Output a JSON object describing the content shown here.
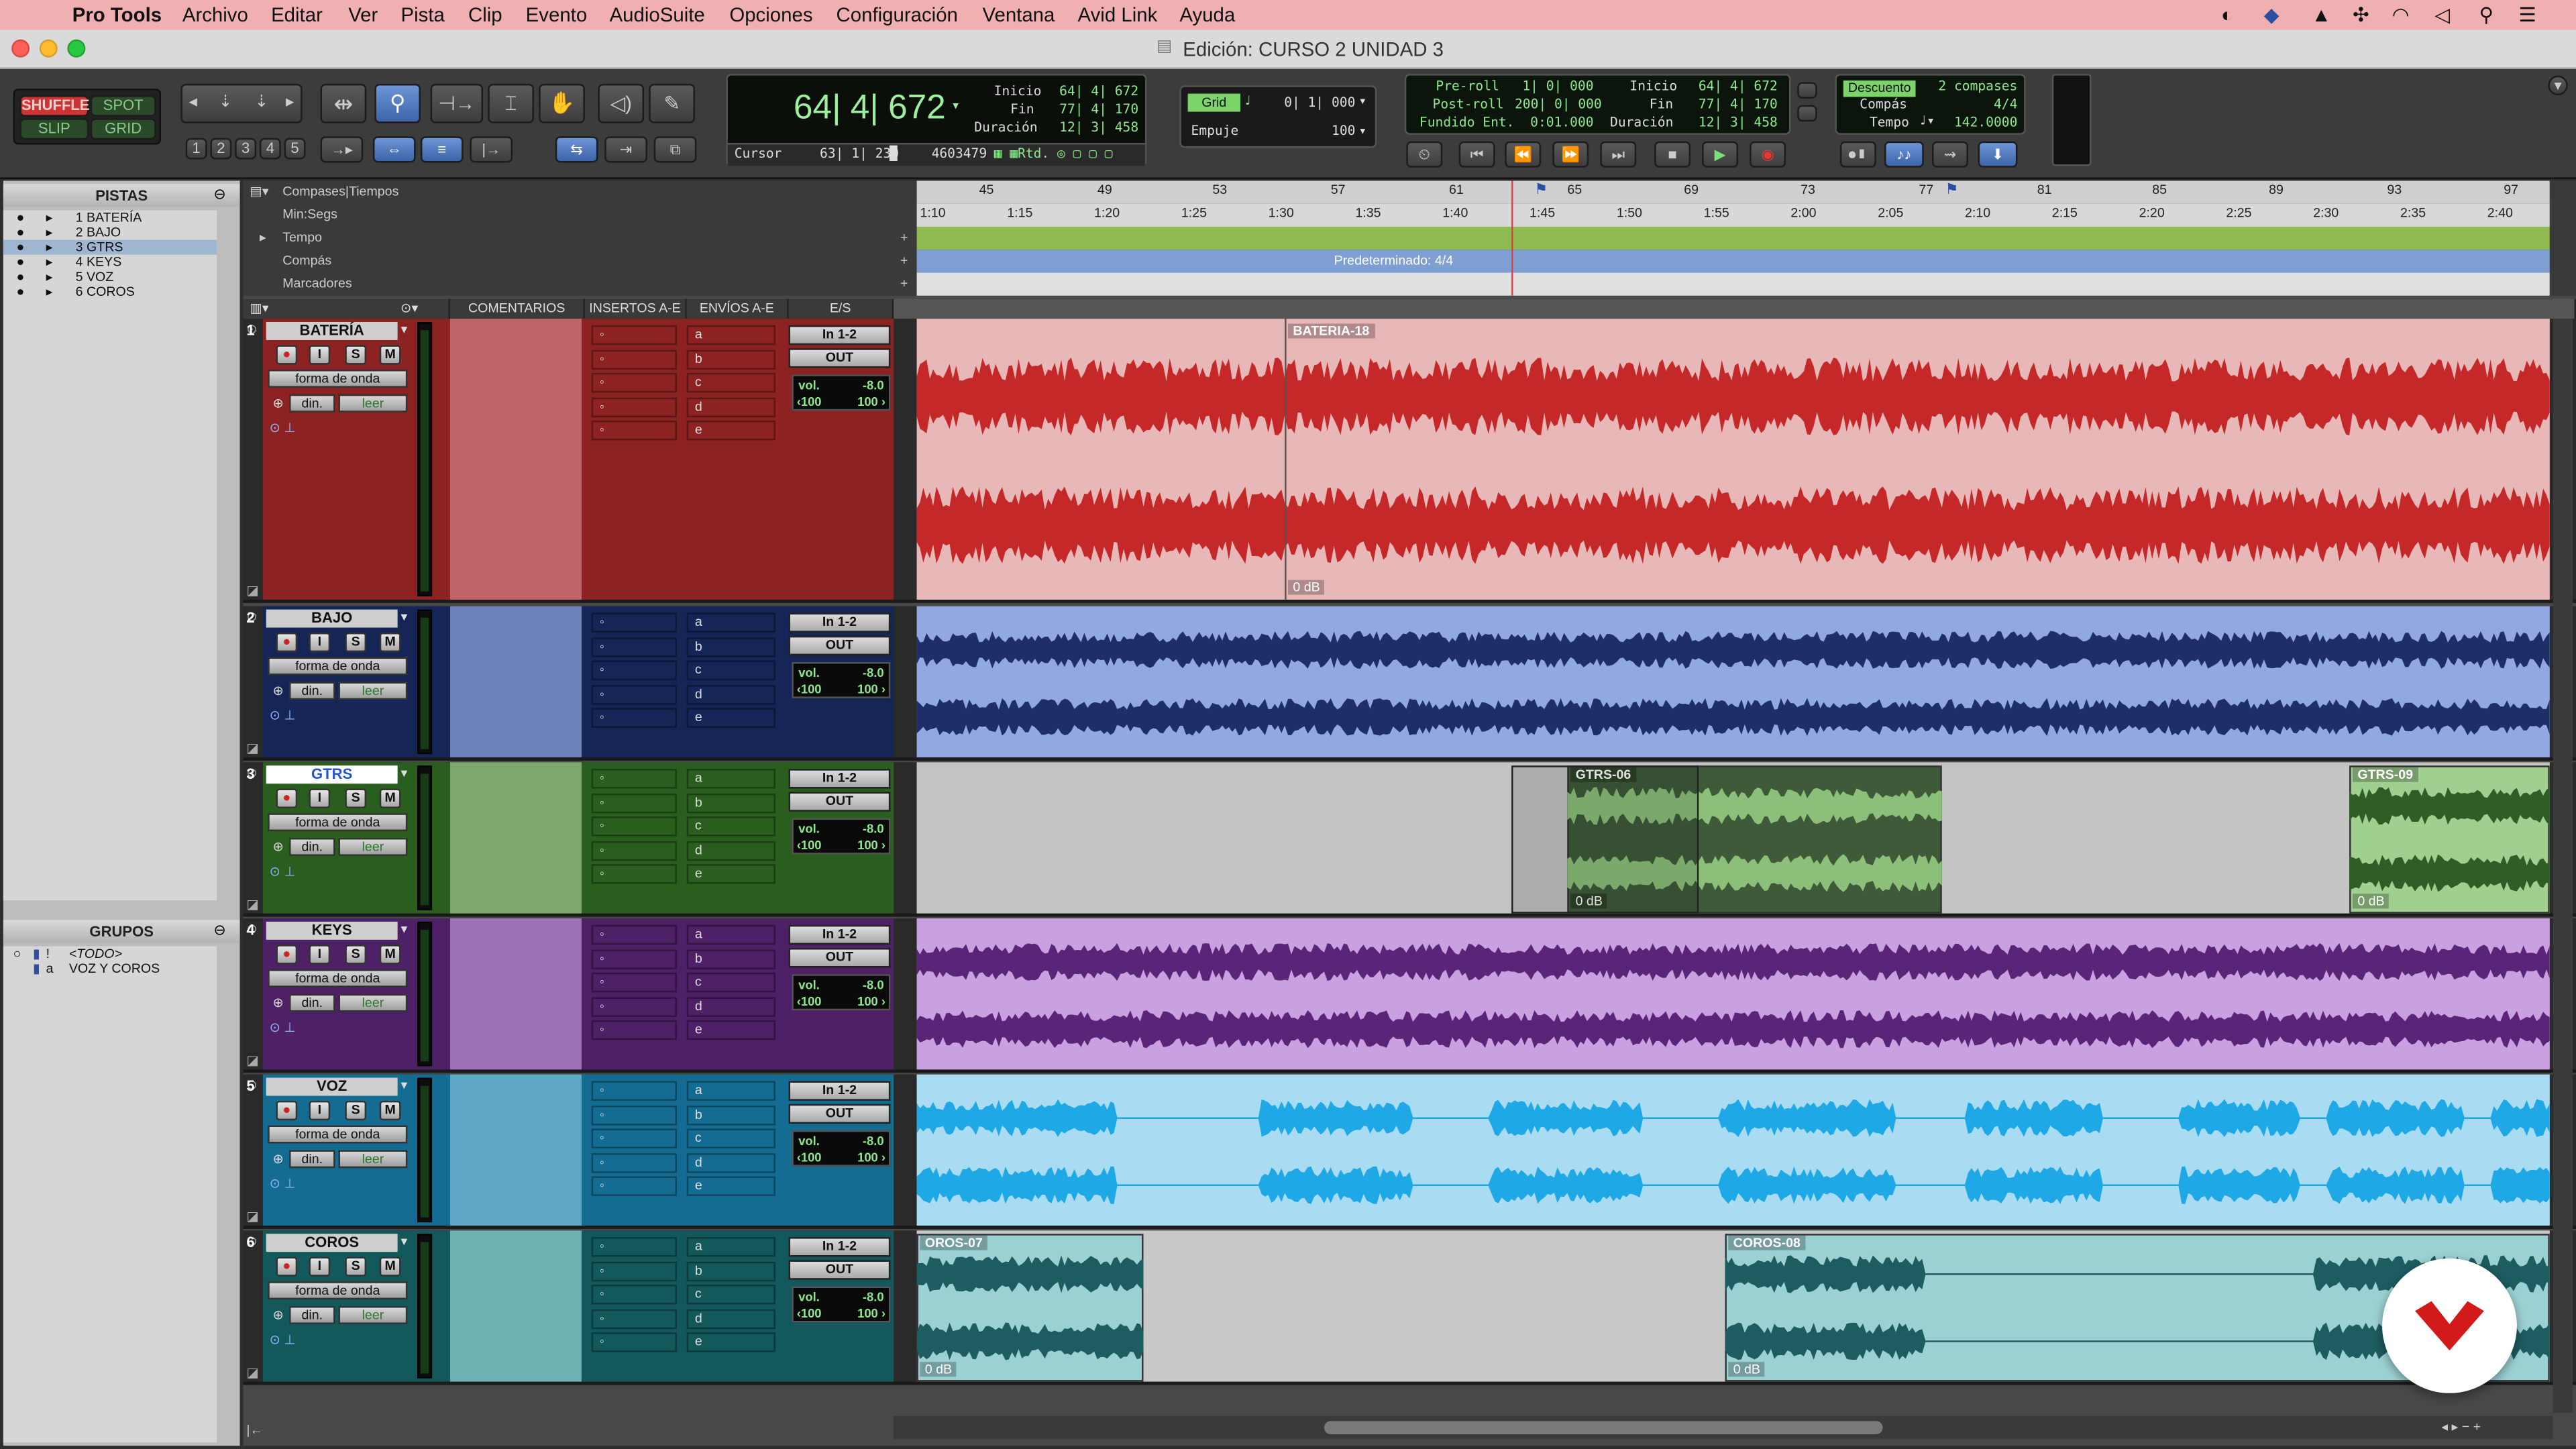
{
  "menubar": {
    "app": "Pro Tools",
    "items": [
      "Archivo",
      "Editar",
      "Ver",
      "Pista",
      "Clip",
      "Evento",
      "AudioSuite",
      "Opciones",
      "Configuración",
      "Ventana",
      "Avid Link",
      "Ayuda"
    ]
  },
  "window": {
    "title": "Edición: CURSO 2 UNIDAD 3"
  },
  "toolbar": {
    "modes": {
      "shuffle": "SHUFFLE",
      "spot": "SPOT",
      "slip": "SLIP",
      "grid": "GRID"
    },
    "zoom_presets": [
      "1",
      "2",
      "3",
      "4",
      "5"
    ],
    "main_counter": "64| 4| 672",
    "cursor_label": "Cursor",
    "cursor_value": "63| 1| 230",
    "cursor_samples": "4603479",
    "selection": {
      "inicio_label": "Inicio",
      "inicio": "64| 4| 672",
      "fin_label": "Fin",
      "fin": "77| 4| 170",
      "duracion_label": "Duración",
      "duracion": "12| 3| 458"
    },
    "grid": {
      "label": "Grid",
      "value": "0| 1| 000",
      "empuje_label": "Empuje",
      "empuje_value": "100"
    },
    "transport_counters": {
      "preroll_label": "Pre-roll",
      "preroll": "1| 0| 000",
      "postroll_label": "Post-roll",
      "postroll": "200| 0| 000",
      "fundido_label": "Fundido Ent.",
      "fundido": "0:01.000",
      "inicio_label": "Inicio",
      "inicio": "64| 4| 672",
      "fin_label": "Fin",
      "fin": "77| 4| 170",
      "duracion_label": "Duración",
      "duracion": "12| 3| 458"
    },
    "tempo_box": {
      "descuento_label": "Descuento",
      "descuento_value": "2 compases",
      "compas_label": "Compás",
      "compas_value": "4/4",
      "tempo_label": "Tempo",
      "tempo_value": "142.0000"
    }
  },
  "left_panel": {
    "tracks_title": "PISTAS",
    "tracks": [
      "1 BATERÍA",
      "2 BAJO",
      "3 GTRS",
      "4 KEYS",
      "5 VOZ",
      "6 COROS"
    ],
    "selected_track_index": 2,
    "groups_title": "GRUPOS",
    "groups": [
      {
        "id": "!",
        "name": "<TODO>"
      },
      {
        "id": "a",
        "name": "VOZ Y COROS"
      }
    ]
  },
  "rulers": {
    "bars_label": "Compases|Tiempos",
    "bar_numbers": [
      "45",
      "49",
      "53",
      "57",
      "61",
      "65",
      "69",
      "73",
      "77",
      "81",
      "85",
      "89",
      "93",
      "97"
    ],
    "minsec_label": "Min:Segs",
    "minsec_ticks": [
      "1:10",
      "1:15",
      "1:20",
      "1:25",
      "1:30",
      "1:35",
      "1:40",
      "1:45",
      "1:50",
      "1:55",
      "2:00",
      "2:05",
      "2:10",
      "2:15",
      "2:20",
      "2:25",
      "2:30",
      "2:35",
      "2:40"
    ],
    "tempo_label": "Tempo",
    "meter_label": "Compás",
    "meter_value": "Predeterminado: 4/4",
    "markers_label": "Marcadores"
  },
  "columns": {
    "comments": "COMENTARIOS",
    "inserts": "INSERTOS A-E",
    "sends": "ENVÍOS A-E",
    "io": "E/S"
  },
  "track_controls": {
    "rec": "●",
    "input": "I",
    "solo": "S",
    "mute": "M",
    "view": "forma de onda",
    "dyn": "din.",
    "auto": "leer",
    "in": "In 1-2",
    "out": "OUT",
    "vol_label": "vol.",
    "vol": "-8.0",
    "pan_l": "‹100",
    "pan_r": "100 ›"
  },
  "send_letters": [
    "a",
    "b",
    "c",
    "d",
    "e"
  ],
  "tracks": [
    {
      "num": "1",
      "name": "BATERÍA",
      "color": "#b23a3a",
      "lane_bg": "#e8b8b8",
      "wave": "#c42828",
      "ctrl_bg": "#8c2222",
      "comment_bg": "#c0666a",
      "clips": [
        {
          "name": "BATERIA-18",
          "gain": "0 dB"
        }
      ]
    },
    {
      "num": "2",
      "name": "BAJO",
      "color": "#2e4d94",
      "lane_bg": "#92a8e0",
      "wave": "#1d2f66",
      "ctrl_bg": "#152555",
      "comment_bg": "#6d82b8",
      "clips": []
    },
    {
      "num": "3",
      "name": "GTRS",
      "color": "#3e7f2c",
      "lane_bg": "#c4c4c4",
      "wave": "#2e5e25",
      "ctrl_bg": "#2a5e1e",
      "comment_bg": "#7ea86c",
      "clips": [
        {
          "name": "GTRS-06",
          "gain": "0 dB"
        },
        {
          "name": "GTRS-09",
          "gain": "0 dB"
        }
      ]
    },
    {
      "num": "4",
      "name": "KEYS",
      "color": "#7a3d96",
      "lane_bg": "#c9a0e0",
      "wave": "#5a2478",
      "ctrl_bg": "#4e2066",
      "comment_bg": "#9e72b8",
      "clips": []
    },
    {
      "num": "5",
      "name": "VOZ",
      "color": "#2e9cc9",
      "lane_bg": "#a9dcf2",
      "wave": "#1ea8e6",
      "ctrl_bg": "#156c92",
      "comment_bg": "#5fa8c8",
      "clips": []
    },
    {
      "num": "6",
      "name": "COROS",
      "color": "#2b8f93",
      "lane_bg": "#c8c8c8",
      "wave": "#1d5c60",
      "ctrl_bg": "#13595c",
      "comment_bg": "#6fb2b4",
      "clips": [
        {
          "name": "OROS-07",
          "gain": "0 dB"
        },
        {
          "name": "COROS-08",
          "gain": "0 dB"
        }
      ]
    }
  ]
}
